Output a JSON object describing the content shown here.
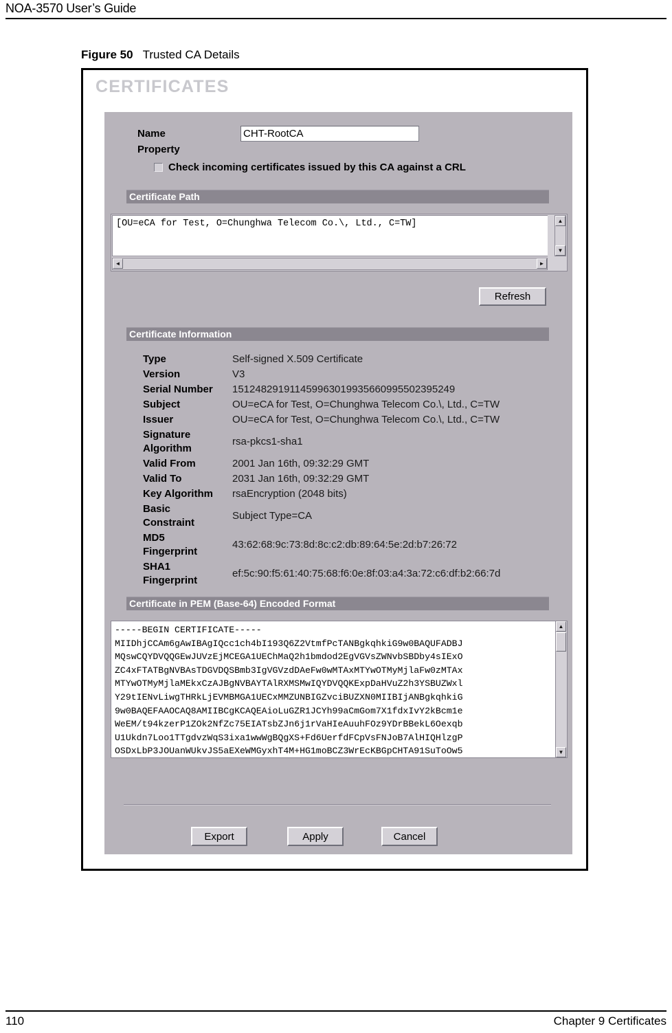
{
  "page": {
    "header_title": "NOA-3570 User’s Guide",
    "page_number": "110",
    "chapter_label": "Chapter 9 Certificates"
  },
  "figure": {
    "number": "Figure 50",
    "title": "Trusted CA Details"
  },
  "screen": {
    "title": "CERTIFICATES",
    "name": {
      "label": "Name",
      "value": "CHT-RootCA"
    },
    "property": {
      "label": "Property",
      "crl_checkbox_label": "Check incoming certificates issued by this CA against a CRL",
      "crl_checked": false
    },
    "certificate_path": {
      "section_title": "Certificate Path",
      "text": "[OU=eCA for Test, O=Chunghwa Telecom Co.\\, Ltd., C=TW]",
      "refresh_label": "Refresh"
    },
    "certificate_information": {
      "section_title": "Certificate Information",
      "rows": [
        {
          "key": "Type",
          "value": "Self-signed X.509 Certificate",
          "two_line": false
        },
        {
          "key": "Version",
          "value": "V3",
          "two_line": false
        },
        {
          "key": "Serial Number",
          "value": "151248291911459963019935660995502395249",
          "two_line": false
        },
        {
          "key": "Subject",
          "value": "OU=eCA for Test, O=Chunghwa Telecom Co.\\, Ltd., C=TW",
          "two_line": false
        },
        {
          "key": "Issuer",
          "value": "OU=eCA for Test, O=Chunghwa Telecom Co.\\, Ltd., C=TW",
          "two_line": false
        },
        {
          "key": "Signature\nAlgorithm",
          "value": "rsa-pkcs1-sha1",
          "two_line": true
        },
        {
          "key": "Valid From",
          "value": "2001 Jan 16th, 09:32:29 GMT",
          "two_line": false
        },
        {
          "key": "Valid To",
          "value": "2031 Jan 16th, 09:32:29 GMT",
          "two_line": false
        },
        {
          "key": "Key Algorithm",
          "value": "rsaEncryption (2048 bits)",
          "two_line": false
        },
        {
          "key": "Basic\nConstraint",
          "value": "Subject Type=CA",
          "two_line": true
        },
        {
          "key": "MD5\nFingerprint",
          "value": "43:62:68:9c:73:8d:8c:c2:db:89:64:5e:2d:b7:26:72",
          "two_line": true
        },
        {
          "key": "SHA1\nFingerprint",
          "value": "ef:5c:90:f5:61:40:75:68:f6:0e:8f:03:a4:3a:72:c6:df:b2:66:7d",
          "two_line": true
        }
      ]
    },
    "certificate_pem": {
      "section_title": "Certificate in PEM (Base-64) Encoded Format",
      "text": "-----BEGIN CERTIFICATE-----\nMIIDhjCCAm6gAwIBAgIQcc1ch4bI193Q6Z2VtmfPcTANBgkqhkiG9w0BAQUFADBJ\nMQswCQYDVQQGEwJUVzEjMCEGA1UEChMaQ2h1bmdod2EgVGVsZWNvbSBDby4sIExO\nZC4xFTATBgNVBAsTDGVDQSBmb3IgVGVzdDAeFw0wMTAxMTYwOTMyMjlaFw0zMTAx\nMTYwOTMyMjlaMEkxCzAJBgNVBAYTAlRXMSMwIQYDVQQKExpDaHVuZ2h3YSBUZWxl\nY29tIENvLiwgTHRkLjEVMBMGA1UECxMMZUNBIGZvciBUZXN0MIIBIjANBgkqhkiG\n9w0BAQEFAAOCAQ8AMIIBCgKCAQEAioLuGZR1JCYh99aCmGom7X1fdxIvY2kBcm1e\nWeEM/t94kzerP1ZOk2NfZc75EIATsbZJn6j1rVaHIeAuuhFOz9YDrBBekL6Oexqb\nU1Ukdn7Loo1TTgdvzWqS3ixa1wwWgBQgXS+Fd6UerfdFCpVsFNJoB7AlHIQHlzgP\nOSDxLbP3JOUanWUkvJS5aEXeWMGyxhT4M+HG1moBCZ3WrEcKBGpCHTA91SuToOw5",
      "buttons": {
        "export": "Export",
        "apply": "Apply",
        "cancel": "Cancel"
      }
    },
    "icons": {
      "scroll_up": "▲",
      "scroll_down": "▼",
      "scroll_left": "◄",
      "scroll_right": "►"
    }
  }
}
